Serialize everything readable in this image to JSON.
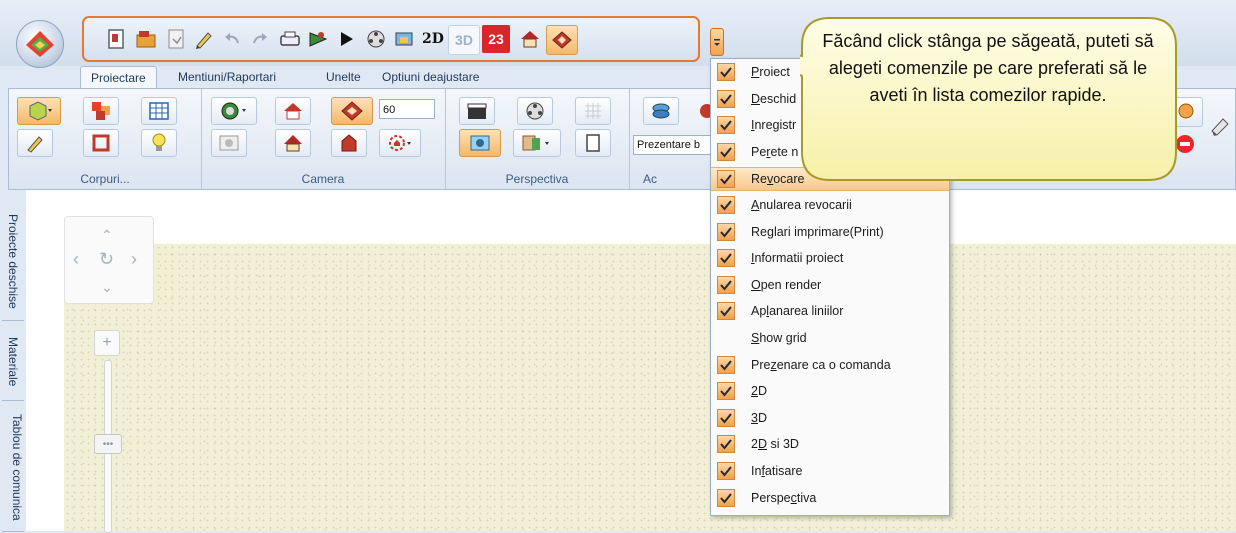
{
  "quick_access": {
    "icons": [
      "new-project-icon",
      "open-folder-icon",
      "save-icon",
      "pencil-icon",
      "undo-icon",
      "redo-icon",
      "print-icon",
      "project-info-icon",
      "render-play-icon",
      "film-reel-icon",
      "smooth-lines-icon",
      "view-2d-icon",
      "view-3d-icon",
      "view-2d-3d-icon",
      "house-front-icon",
      "perspective-house-icon"
    ],
    "label_2d": "2D",
    "label_3d": "3D",
    "label_23": "23"
  },
  "tabs": [
    "Proiectare",
    "Mentiuni/Raportari",
    "Unelte",
    "Optiuni deajustare"
  ],
  "ribbon": {
    "groups": [
      "Corpuri...",
      "Camera",
      "Perspectiva",
      "Ac"
    ],
    "camera_value": "60",
    "presentation_value": "Prezentare b"
  },
  "side_tabs": [
    "Proiecte deschise",
    "Materiale",
    "Tablou de comunica"
  ],
  "menu": {
    "items": [
      {
        "pre": "",
        "u": "P",
        "post": "roiect",
        "checked": true
      },
      {
        "pre": "",
        "u": "D",
        "post": "eschid",
        "checked": true
      },
      {
        "pre": "",
        "u": "I",
        "post": "nregistr",
        "checked": true
      },
      {
        "pre": "Pe",
        "u": "r",
        "post": "ete n",
        "checked": true
      },
      {
        "pre": "Re",
        "u": "v",
        "post": "ocare",
        "checked": true
      },
      {
        "pre": "",
        "u": "A",
        "post": "nularea revocarii",
        "checked": true
      },
      {
        "pre": "Re",
        "u": "g",
        "post": "lari imprimare(Print)",
        "checked": true
      },
      {
        "pre": "",
        "u": "I",
        "post": "nformatii proiect",
        "checked": true
      },
      {
        "pre": "",
        "u": "O",
        "post": "pen render",
        "checked": true
      },
      {
        "pre": "Ap",
        "u": "l",
        "post": "anarea liniilor",
        "checked": true
      },
      {
        "pre": "",
        "u": "S",
        "post": "how grid",
        "checked": false
      },
      {
        "pre": "Pre",
        "u": "z",
        "post": "enare ca o comanda",
        "checked": true
      },
      {
        "pre": "",
        "u": "2",
        "post": "D",
        "checked": true
      },
      {
        "pre": "",
        "u": "3",
        "post": "D",
        "checked": true
      },
      {
        "pre": "2",
        "u": "D",
        "post": " si 3D",
        "checked": true
      },
      {
        "pre": "In",
        "u": "f",
        "post": "atisare",
        "checked": true
      },
      {
        "pre": "Perspe",
        "u": "c",
        "post": "tiva",
        "checked": true
      }
    ]
  },
  "callout": {
    "text": "Făcând click stânga pe săgeată, puteti să alegeti comenzile pe care preferati să le aveti în lista comezilor rapide."
  },
  "colors": {
    "accent_orange": "#e8782a",
    "callout_yellow": "#fffbd0",
    "menu_highlight": "#f7c98b"
  }
}
